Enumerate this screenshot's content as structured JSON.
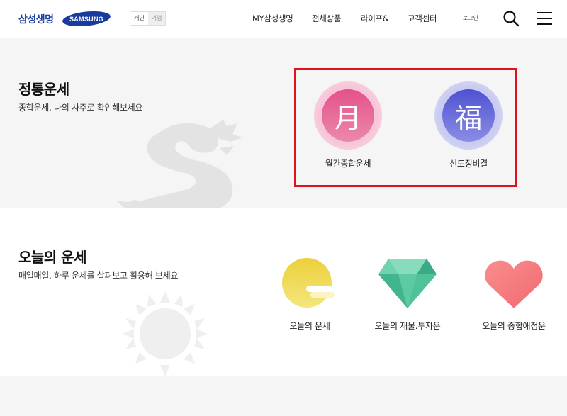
{
  "header": {
    "brand": "삼성생명",
    "partner_logo": "SAMSUNG",
    "segment": {
      "personal": "개인",
      "corporate": "기업"
    },
    "nav": [
      "MY삼성생명",
      "전체상품",
      "라이프&",
      "고객센터"
    ],
    "login": "로그인"
  },
  "section1": {
    "title": "정통운세",
    "desc": "종합운세, 나의 사주로 확인해보세요",
    "items": [
      {
        "glyph": "月",
        "label": "월간종합운세",
        "color": "#e3588a"
      },
      {
        "glyph": "福",
        "label": "신토정비결",
        "color": "#5b5fd6"
      }
    ]
  },
  "section2": {
    "title": "오늘의 운세",
    "desc": "매일매일, 하루 운세를 살펴보고 활용해 보세요",
    "items": [
      {
        "label": "오늘의 운세",
        "icon": "moon-icon"
      },
      {
        "label": "오늘의 재물.투자운",
        "icon": "gem-icon"
      },
      {
        "label": "오늘의 종합애정운",
        "icon": "heart-icon"
      }
    ]
  },
  "colors": {
    "brand": "#1d3f9c",
    "highlight": "#e0111a"
  }
}
